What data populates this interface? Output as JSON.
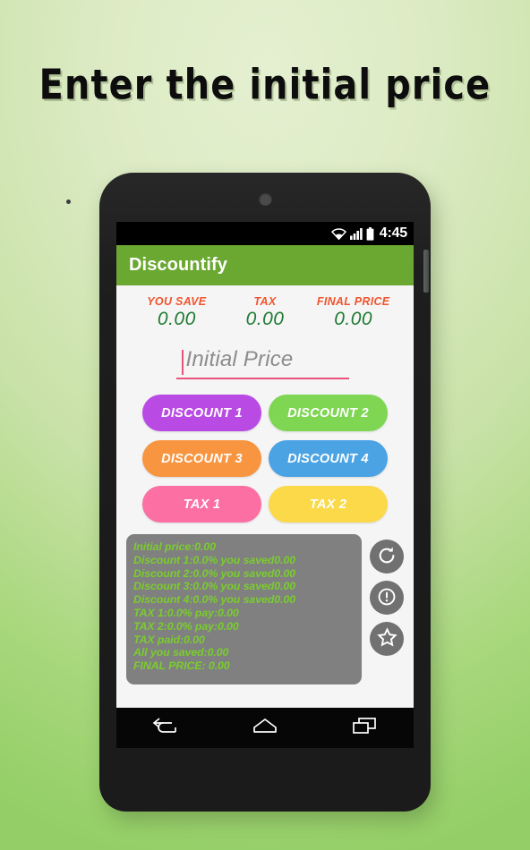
{
  "headline": "Enter the initial price",
  "device": {
    "power_button": "power-button",
    "front_camera": "front-camera",
    "sensor": "proximity-sensor"
  },
  "status_bar": {
    "time": "4:45",
    "icons": [
      "wifi-icon",
      "signal-icon",
      "battery-icon"
    ]
  },
  "app_bar": {
    "title": "Discountify",
    "color": "#6aa832"
  },
  "summary": {
    "items": [
      {
        "label": "YOU SAVE",
        "value": "0.00"
      },
      {
        "label": "TAX",
        "value": "0.00"
      },
      {
        "label": "FINAL PRICE",
        "value": "0.00"
      }
    ],
    "label_color": "#f0552f",
    "value_color": "#1f7a33"
  },
  "input": {
    "placeholder": "Initial Price",
    "value": "",
    "accent_color": "#e8527d"
  },
  "buttons": [
    {
      "label": "DISCOUNT 1",
      "color": "#b94ae4"
    },
    {
      "label": "DISCOUNT 2",
      "color": "#7ed653"
    },
    {
      "label": "DISCOUNT 3",
      "color": "#f79540"
    },
    {
      "label": "DISCOUNT 4",
      "color": "#4ba3e3"
    },
    {
      "label": "TAX 1",
      "color": "#fb6fa3"
    },
    {
      "label": "TAX 2",
      "color": "#fbd949"
    }
  ],
  "results": {
    "background": "#808080",
    "text_color": "#7acc2e",
    "lines": [
      "Initial price:0.00",
      "Discount 1:0.0% you saved0.00",
      "Discount 2:0.0% you saved0.00",
      "Discount 3:0.0% you saved0.00",
      "Discount 4:0.0% you saved0.00",
      "TAX 1:0.0% pay:0.00",
      "TAX 2:0.0% pay:0.00",
      "TAX paid:0.00",
      "All you saved:0.00",
      "FINAL PRICE: 0.00"
    ]
  },
  "side_actions": [
    {
      "name": "reset-button",
      "icon": "refresh-icon"
    },
    {
      "name": "info-button",
      "icon": "exclamation-circle-icon"
    },
    {
      "name": "favorite-button",
      "icon": "star-icon"
    }
  ],
  "nav_bar": [
    {
      "name": "nav-back-button",
      "icon": "back-arrow-icon"
    },
    {
      "name": "nav-home-button",
      "icon": "home-icon"
    },
    {
      "name": "nav-recents-button",
      "icon": "recents-icon"
    }
  ]
}
